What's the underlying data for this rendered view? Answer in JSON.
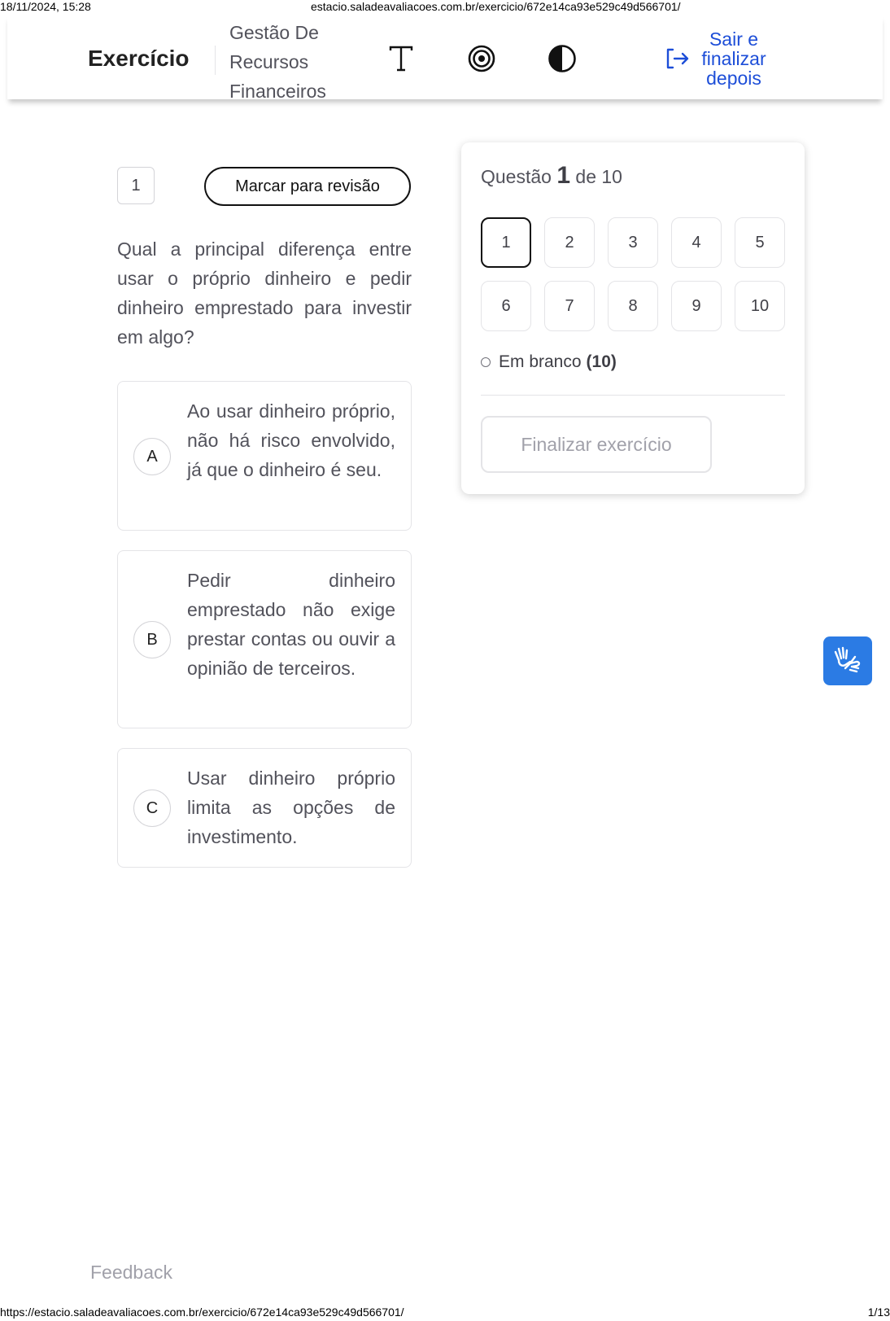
{
  "print": {
    "date": "18/11/2024, 15:28",
    "url_top": "estacio.saladeavaliacoes.com.br/exercicio/672e14ca93e529c49d566701/",
    "url_bottom": "https://estacio.saladeavaliacoes.com.br/exercicio/672e14ca93e529c49d566701/",
    "page": "1/13"
  },
  "header": {
    "title": "Exercício",
    "course": "Gestão De Recursos Financeiros",
    "icons": [
      "text-size-icon",
      "target-icon",
      "contrast-icon"
    ],
    "exit_label": "Sair e finalizar depois",
    "exit_color": "#1d4ed8"
  },
  "question": {
    "number": "1",
    "mark_review_label": "Marcar para revisão",
    "text": "Qual a principal diferença entre usar o próprio dinheiro e pedir dinheiro emprestado para investir em algo?",
    "options": [
      {
        "letter": "A",
        "text": "Ao usar dinheiro próprio, não há risco envolvido, já que o dinheiro é seu."
      },
      {
        "letter": "B",
        "text": "Pedir dinheiro emprestado não exige prestar contas ou ouvir a opinião de terceiros."
      },
      {
        "letter": "C",
        "text": "Usar dinheiro próprio limita as opções de investimento."
      }
    ]
  },
  "panel": {
    "title_prefix": "Questão",
    "current": "1",
    "title_suffix": "de 10",
    "numbers": [
      "1",
      "2",
      "3",
      "4",
      "5",
      "6",
      "7",
      "8",
      "9",
      "10"
    ],
    "status_label": "Em branco",
    "status_count": "(10)",
    "finish_label": "Finalizar exercício"
  },
  "accessibility": {
    "icon": "sign-language-icon",
    "color": "#2b7be4"
  },
  "footer": {
    "feedback_label": "Feedback"
  }
}
